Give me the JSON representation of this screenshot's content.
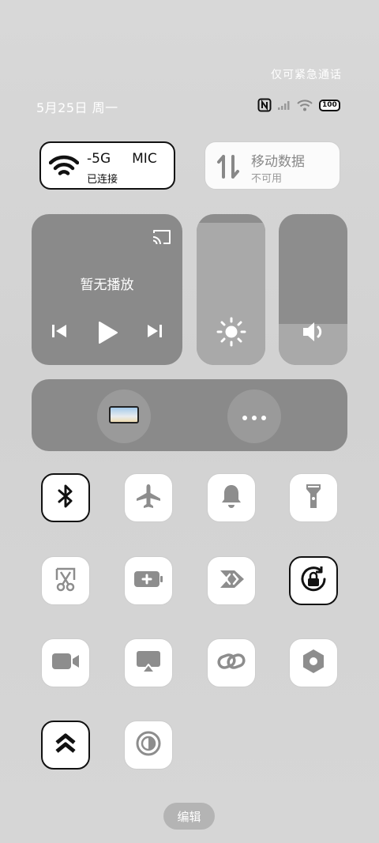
{
  "status": {
    "emergency_text": "仅可紧急通话",
    "date_text": "5月25日 周一",
    "battery_text": "100",
    "icons": [
      "nfc-icon",
      "signal-icon",
      "wifi-signal-icon",
      "battery-icon"
    ]
  },
  "wifi_tile": {
    "ssid": "-5G     MIC",
    "status": "已连接",
    "icon": "wifi-icon",
    "active": true
  },
  "mobile_tile": {
    "title": "移动数据",
    "status": "不可用",
    "icon": "mobile-data-icon",
    "active": false
  },
  "media": {
    "now_playing": "暂无播放",
    "icons": [
      "cast-icon",
      "previous-icon",
      "play-icon",
      "next-icon"
    ]
  },
  "brightness": {
    "icon": "brightness-icon",
    "level": 0.94
  },
  "volume": {
    "icon": "volume-icon",
    "level": 0.27
  },
  "shortcuts": {
    "icons": [
      "screen-mirror-icon",
      "more-icon"
    ]
  },
  "toggles": [
    {
      "name": "bluetooth",
      "icon": "bluetooth-icon",
      "active": true
    },
    {
      "name": "airplane-mode",
      "icon": "airplane-icon",
      "active": false
    },
    {
      "name": "ringer",
      "icon": "bell-icon",
      "active": false
    },
    {
      "name": "flashlight",
      "icon": "flashlight-icon",
      "active": false
    },
    {
      "name": "screenshot",
      "icon": "scissors-icon",
      "active": false
    },
    {
      "name": "battery-saver",
      "icon": "battery-plus-icon",
      "active": false
    },
    {
      "name": "nearby-share",
      "icon": "share-arrow-icon",
      "active": false
    },
    {
      "name": "rotation-lock",
      "icon": "rotation-lock-icon",
      "active": true
    },
    {
      "name": "screen-record",
      "icon": "video-camera-icon",
      "active": false
    },
    {
      "name": "screen-cast",
      "icon": "airplay-icon",
      "active": false
    },
    {
      "name": "link",
      "icon": "link-icon",
      "active": false
    },
    {
      "name": "settings",
      "icon": "hex-nut-icon",
      "active": false
    },
    {
      "name": "performance-mode",
      "icon": "double-chevron-up-icon",
      "active": true
    },
    {
      "name": "dark-mode",
      "icon": "contrast-icon",
      "active": false
    }
  ],
  "edit_label": "编辑",
  "colors": {
    "active_border": "#111111",
    "tile_dark": "#8a8a8a",
    "icon_gray": "#8d8d8d"
  }
}
